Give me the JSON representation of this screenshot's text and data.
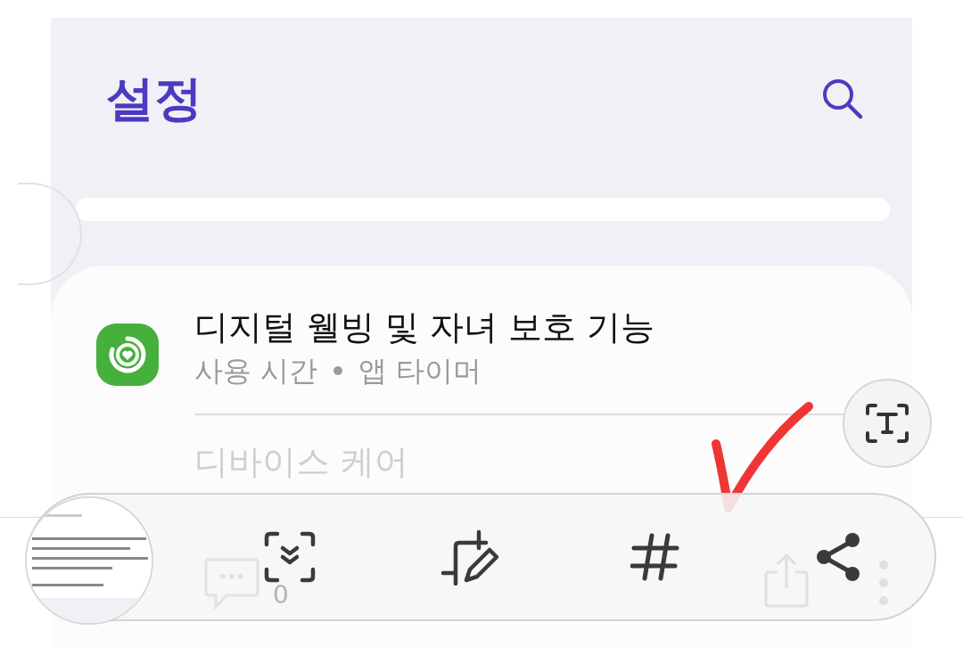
{
  "header": {
    "title": "설정"
  },
  "settings_items": [
    {
      "title": "디지털 웰빙 및 자녀 보호 기능",
      "subtitle": [
        "사용 시간",
        "앱 타이머"
      ],
      "has_icon": true
    },
    {
      "title": "디바이스 케어",
      "has_icon": false
    }
  ],
  "background_post": {
    "comment_count": "0"
  },
  "screenshot_toolbar": {
    "actions": [
      {
        "kind": "scroll-capture"
      },
      {
        "kind": "edit"
      },
      {
        "kind": "tag"
      },
      {
        "kind": "share"
      }
    ]
  }
}
